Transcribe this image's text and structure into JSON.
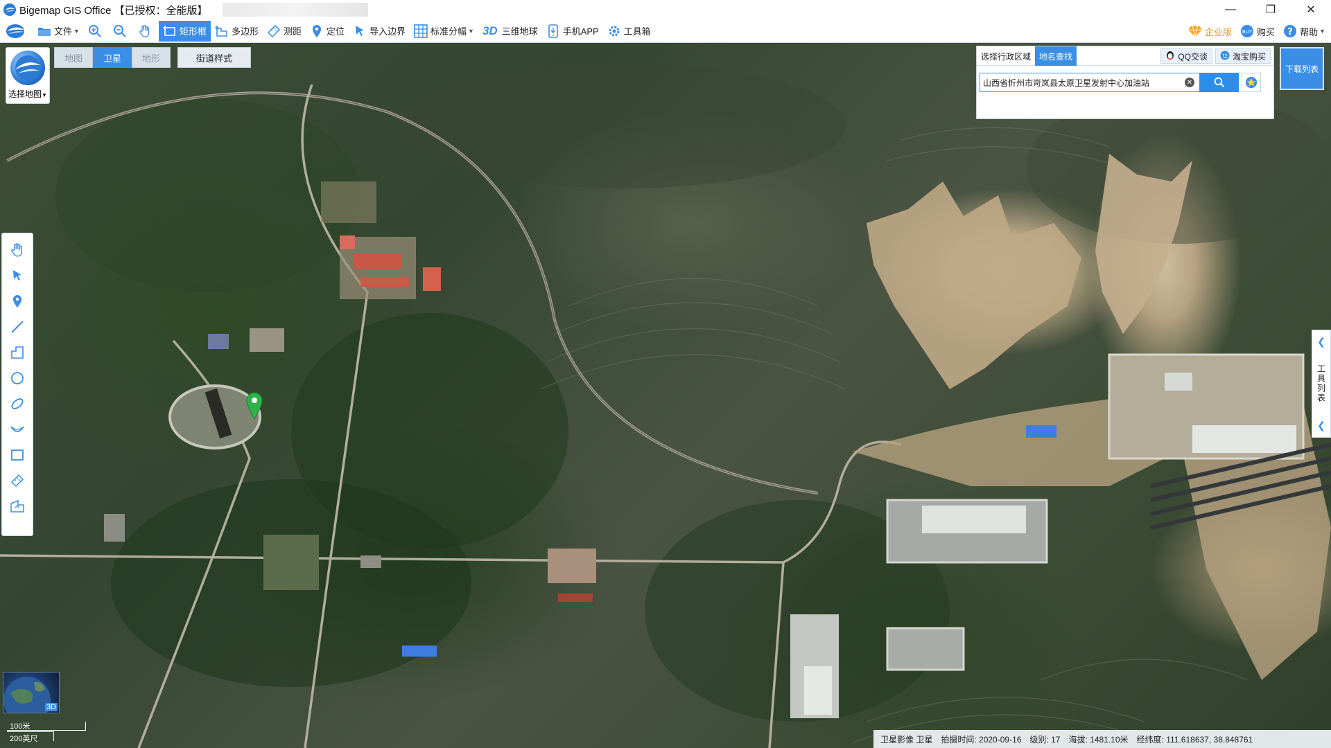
{
  "window": {
    "title": "Bigemap GIS Office 【已授权：全能版】",
    "controls": {
      "minimize": "—",
      "restore": "❐",
      "close": "✕"
    }
  },
  "toolbar": {
    "file": "文件",
    "rect_select": "矩形框",
    "polygon": "多边形",
    "measure": "测距",
    "locate": "定位",
    "import_boundary": "导入边界",
    "standard_grid": "标准分幅",
    "three_d": "3D",
    "globe3d": "三维地球",
    "mobile_app": "手机APP",
    "toolbox": "工具箱",
    "enterprise": "企业版",
    "buy": "购买",
    "help": "帮助",
    "active_tool": "矩形框"
  },
  "map_controls": {
    "select_map": "选择地图",
    "types": [
      "地图",
      "卫星",
      "地形"
    ],
    "active_type": "卫星",
    "street_style": "街道样式"
  },
  "search": {
    "tab_region": "选择行政区域",
    "tab_place": "地名查找",
    "qq": "QQ交谈",
    "taobao": "淘宝购买",
    "value": "山西省忻州市岢岚县太原卫星发射中心加油站",
    "placeholder": ""
  },
  "download_list": "下载列表",
  "tool_list": "工具列表",
  "minimap": {
    "badge": "3D"
  },
  "scale": {
    "zoom_percent": "100米",
    "distance": "200英尺"
  },
  "status": {
    "imagery": "卫星影像 卫星",
    "capture_time_label": "拍摄时间:",
    "capture_time": "2020-09-16",
    "level_label": "级别:",
    "level": "17",
    "elevation_label": "海拔:",
    "elevation": "1481.10米",
    "coords_label": "经纬度:",
    "coords": "111.618637, 38.848761"
  },
  "colors": {
    "accent": "#3a8ee6",
    "marker": "#2db34a"
  }
}
